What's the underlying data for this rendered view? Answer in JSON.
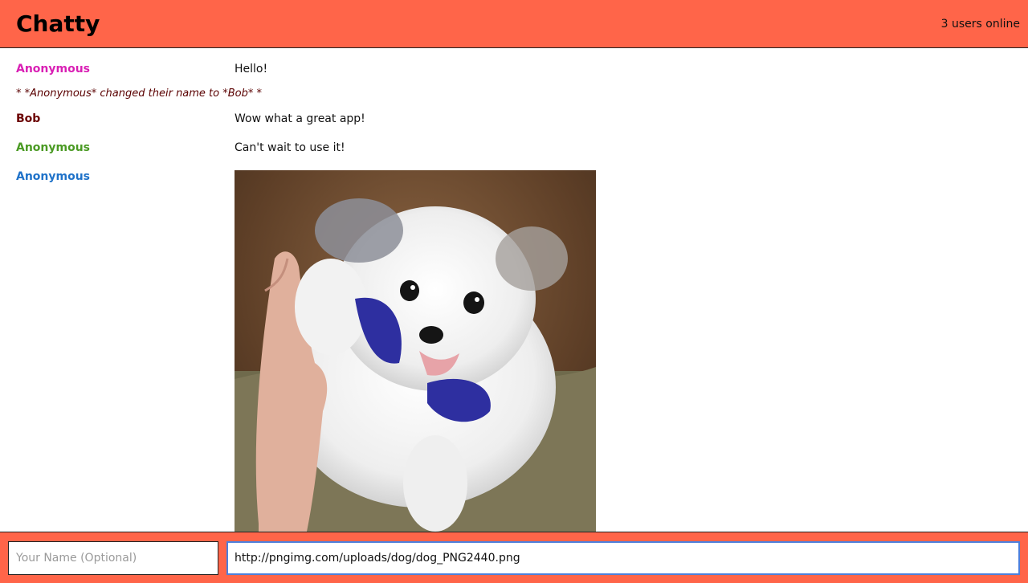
{
  "navbar": {
    "brand": "Chatty",
    "user_count": "3 users online"
  },
  "messages": [
    {
      "type": "message",
      "username": "Anonymous",
      "username_color": "#d91fb4",
      "content": "Hello!"
    },
    {
      "type": "notification",
      "content": "* *Anonymous* changed their name to *Bob* *"
    },
    {
      "type": "message",
      "username": "Bob",
      "username_color": "#6b0000",
      "content": "Wow what a great app!"
    },
    {
      "type": "message",
      "username": "Anonymous",
      "username_color": "#4a9a23",
      "content": "Can't wait to use it!"
    },
    {
      "type": "image",
      "username": "Anonymous",
      "username_color": "#1f72c9",
      "image": "white fluffy dog holding a blue toy, giving a high five"
    }
  ],
  "chatbar": {
    "name_placeholder": "Your Name (Optional)",
    "name_value": "",
    "message_value": "http://pngimg.com/uploads/dog/dog_PNG2440.png"
  },
  "colors": {
    "accent": "#ff6549",
    "focus_border": "#4d7fdc"
  },
  "icons": {
    "message_image": "dog-photo"
  }
}
